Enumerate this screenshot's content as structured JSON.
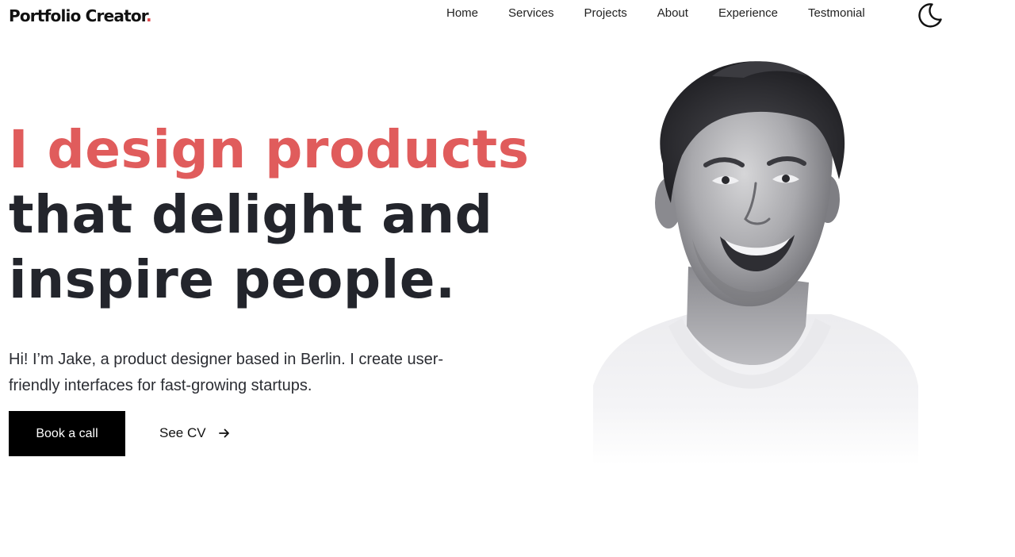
{
  "header": {
    "logo_text": "Portfolio Creator",
    "logo_dot": ".",
    "nav": [
      {
        "label": "Home"
      },
      {
        "label": "Services"
      },
      {
        "label": "Projects"
      },
      {
        "label": "About"
      },
      {
        "label": "Experience"
      },
      {
        "label": "Testmonial"
      }
    ],
    "theme_toggle_icon": "moon-icon"
  },
  "hero": {
    "headline_accent": "I design products",
    "headline_line2": "that delight and",
    "headline_line3": "inspire people.",
    "intro": "Hi! I’m Jake, a product designer based in Berlin. I create user-friendly interfaces for fast-growing startups.",
    "primary_button": "Book a call",
    "secondary_link": "See CV",
    "secondary_link_icon": "arrow-right-icon",
    "portrait_icon": "profile-photo"
  },
  "colors": {
    "accent": "#e05c5c",
    "logo_dot": "#e0484c",
    "text": "#23252c",
    "button_bg": "#000000",
    "background": "#ffffff"
  }
}
